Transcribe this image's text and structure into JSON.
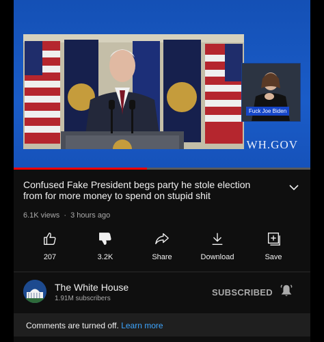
{
  "video": {
    "watermark": "WH.GOV",
    "interpreter_caption": "Fuck Joe Biden",
    "progress_fraction": 0.45
  },
  "info": {
    "title": "Confused Fake President begs party he stole election from for more money to spend on stupid shit",
    "views": "6.1K views",
    "age": "3 hours ago"
  },
  "actions": [
    {
      "label": "207",
      "icon": "thumbs-up-icon"
    },
    {
      "label": "3.2K",
      "icon": "thumbs-down-icon"
    },
    {
      "label": "Share",
      "icon": "share-icon"
    },
    {
      "label": "Download",
      "icon": "download-icon"
    },
    {
      "label": "Save",
      "icon": "save-icon"
    }
  ],
  "channel": {
    "name": "The White House",
    "subscribers": "1.91M subscribers",
    "subscribe_label": "SUBSCRIBED"
  },
  "comments": {
    "text": "Comments are turned off.",
    "link": "Learn more"
  },
  "colors": {
    "accent_red": "#ff0000",
    "link_blue": "#3ea6ff",
    "video_blue": "#1a5cc8"
  }
}
